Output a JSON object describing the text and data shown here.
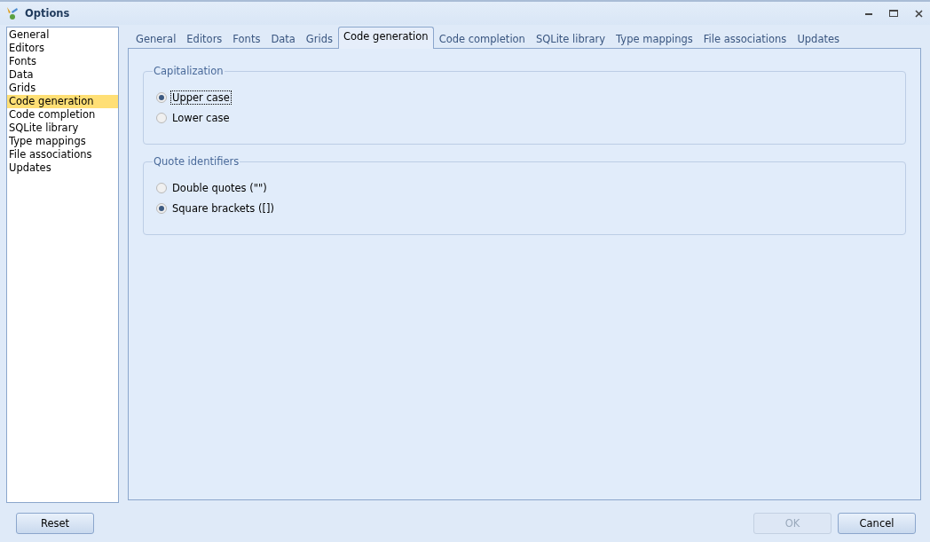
{
  "window": {
    "title": "Options"
  },
  "sidebar": {
    "items": [
      {
        "label": "General",
        "selected": false
      },
      {
        "label": "Editors",
        "selected": false
      },
      {
        "label": "Fonts",
        "selected": false
      },
      {
        "label": "Data",
        "selected": false
      },
      {
        "label": "Grids",
        "selected": false
      },
      {
        "label": "Code generation",
        "selected": true
      },
      {
        "label": "Code completion",
        "selected": false
      },
      {
        "label": "SQLite library",
        "selected": false
      },
      {
        "label": "Type mappings",
        "selected": false
      },
      {
        "label": "File associations",
        "selected": false
      },
      {
        "label": "Updates",
        "selected": false
      }
    ]
  },
  "tabs": [
    {
      "label": "General",
      "selected": false
    },
    {
      "label": "Editors",
      "selected": false
    },
    {
      "label": "Fonts",
      "selected": false
    },
    {
      "label": "Data",
      "selected": false
    },
    {
      "label": "Grids",
      "selected": false
    },
    {
      "label": "Code generation",
      "selected": true
    },
    {
      "label": "Code completion",
      "selected": false
    },
    {
      "label": "SQLite library",
      "selected": false
    },
    {
      "label": "Type mappings",
      "selected": false
    },
    {
      "label": "File associations",
      "selected": false
    },
    {
      "label": "Updates",
      "selected": false
    }
  ],
  "groups": [
    {
      "title": "Capitalization",
      "options": [
        {
          "label": "Upper case",
          "selected": true,
          "focused": true
        },
        {
          "label": "Lower case",
          "selected": false,
          "focused": false
        }
      ]
    },
    {
      "title": "Quote identifiers",
      "options": [
        {
          "label": "Double quotes (\"\")",
          "selected": false,
          "focused": false
        },
        {
          "label": "Square brackets ([])",
          "selected": true,
          "focused": false
        }
      ]
    }
  ],
  "buttons": [
    {
      "label": "Reset",
      "kind": "left",
      "disabled": false
    },
    {
      "label": "OK",
      "kind": "right",
      "disabled": true
    },
    {
      "label": "Cancel",
      "kind": "right",
      "disabled": false
    }
  ]
}
